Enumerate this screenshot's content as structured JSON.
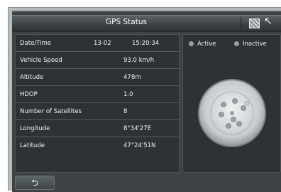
{
  "header": {
    "title": "GPS Status",
    "map_icon": "map-icon",
    "cursor_icon": "cursor-arrow-icon"
  },
  "info": {
    "date_time_label": "Date/Time",
    "date_value": "13-02",
    "time_value": "15:20:34",
    "rows": [
      {
        "label": "Vehicle Speed",
        "value": "93.0 km/h"
      },
      {
        "label": "Altitude",
        "value": "478m"
      },
      {
        "label": "HDOP",
        "value": "1.0"
      },
      {
        "label": "Number of Satellites",
        "value": "8"
      },
      {
        "label": "Longitude",
        "value": "8°34'27E"
      },
      {
        "label": "Latitude",
        "value": "47°24'51N"
      }
    ]
  },
  "legend": {
    "active": "Active",
    "inactive": "Inactive"
  },
  "footer": {
    "back_icon": "back-arrow-icon",
    "back_glyph": "⮌"
  },
  "colors": {
    "background": "#3d4245",
    "panel": "#2d3235",
    "text": "#f2f2f2",
    "satellite": "#9a9fa2"
  }
}
